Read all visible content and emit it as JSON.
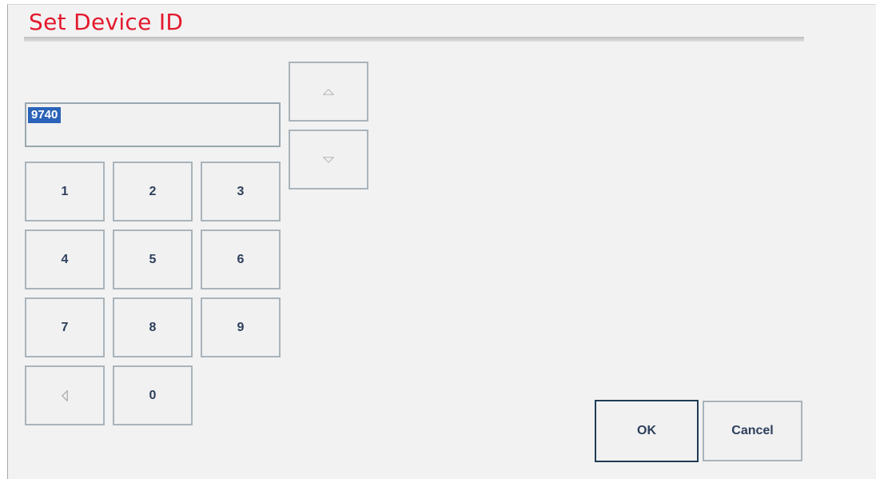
{
  "dialog": {
    "title": "Set Device ID",
    "title_color": "#e3192d"
  },
  "device_id": {
    "value": "9740",
    "selection_color": "#2a63b8"
  },
  "keypad": {
    "keys": [
      "1",
      "2",
      "3",
      "4",
      "5",
      "6",
      "7",
      "8",
      "9",
      "0"
    ],
    "backspace_icon": "triangle-left-icon"
  },
  "stepper": {
    "up_icon": "triangle-up-icon",
    "down_icon": "triangle-down-icon"
  },
  "actions": {
    "ok_label": "OK",
    "cancel_label": "Cancel"
  }
}
